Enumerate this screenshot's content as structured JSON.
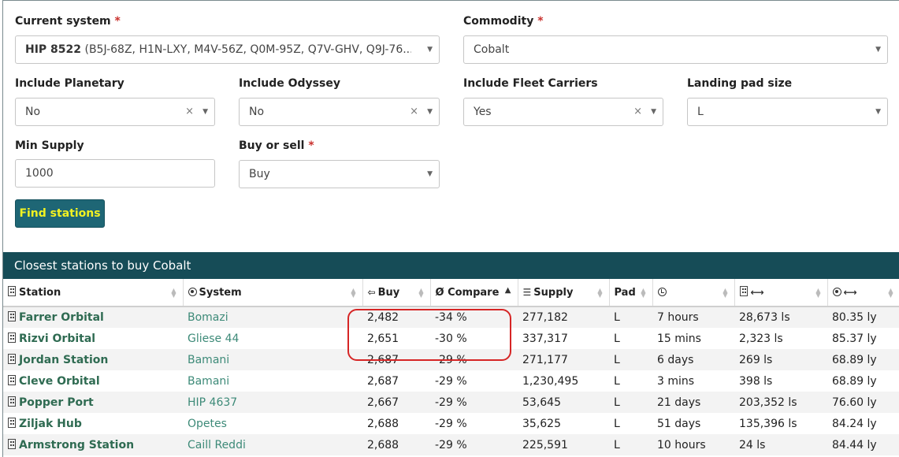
{
  "form": {
    "current_system": {
      "label": "Current system",
      "required_mark": "*",
      "value_bold": "HIP 8522",
      "value_rest": " (B5J-68Z, H1N-LXY, M4V-56Z, Q0M-95Z, Q7V-GHV, Q9J-76..."
    },
    "commodity": {
      "label": "Commodity",
      "required_mark": "*",
      "value": "Cobalt"
    },
    "include_planetary": {
      "label": "Include Planetary",
      "value": "No",
      "clear": "×"
    },
    "include_odyssey": {
      "label": "Include Odyssey",
      "value": "No",
      "clear": "×"
    },
    "include_fleet_carriers": {
      "label": "Include Fleet Carriers",
      "value": "Yes",
      "clear": "×"
    },
    "landing_pad_size": {
      "label": "Landing pad size",
      "value": "L"
    },
    "min_supply": {
      "label": "Min Supply",
      "value": "1000"
    },
    "buy_or_sell": {
      "label": "Buy or sell",
      "required_mark": "*",
      "value": "Buy"
    },
    "find_button": "Find stations"
  },
  "results": {
    "title": "Closest stations to buy Cobalt",
    "columns": [
      "Station",
      "System",
      "Buy",
      "Ø Compare",
      "Supply",
      "Pad",
      "",
      "",
      ""
    ],
    "rows": [
      {
        "station": "Farrer Orbital",
        "system": "Bomazi",
        "buy": "2,482",
        "compare": "-34 %",
        "supply": "277,182",
        "pad": "L",
        "updated": "7 hours",
        "arrival": "28,673 ls",
        "distance": "80.35 ly"
      },
      {
        "station": "Rizvi Orbital",
        "system": "Gliese 44",
        "buy": "2,651",
        "compare": "-30 %",
        "supply": "337,317",
        "pad": "L",
        "updated": "15 mins",
        "arrival": "2,323 ls",
        "distance": "85.37 ly"
      },
      {
        "station": "Jordan Station",
        "system": "Bamani",
        "buy": "2,687",
        "compare": "-29 %",
        "supply": "271,177",
        "pad": "L",
        "updated": "6 days",
        "arrival": "269 ls",
        "distance": "68.89 ly"
      },
      {
        "station": "Cleve Orbital",
        "system": "Bamani",
        "buy": "2,687",
        "compare": "-29 %",
        "supply": "1,230,495",
        "pad": "L",
        "updated": "3 mins",
        "arrival": "398 ls",
        "distance": "68.89 ly"
      },
      {
        "station": "Popper Port",
        "system": "HIP 4637",
        "buy": "2,667",
        "compare": "-29 %",
        "supply": "53,645",
        "pad": "L",
        "updated": "21 days",
        "arrival": "203,352 ls",
        "distance": "76.60 ly"
      },
      {
        "station": "Ziljak Hub",
        "system": "Opetes",
        "buy": "2,688",
        "compare": "-29 %",
        "supply": "35,625",
        "pad": "L",
        "updated": "51 days",
        "arrival": "135,396 ls",
        "distance": "84.24 ly"
      },
      {
        "station": "Armstrong Station",
        "system": "Caill Reddi",
        "buy": "2,688",
        "compare": "-29 %",
        "supply": "225,591",
        "pad": "L",
        "updated": "10 hours",
        "arrival": "24 ls",
        "distance": "84.44 ly"
      }
    ]
  },
  "colors": {
    "header_bg": "#164c57",
    "button_bg": "#1e6675",
    "button_text": "#f2f222",
    "highlight": "#d62525"
  }
}
